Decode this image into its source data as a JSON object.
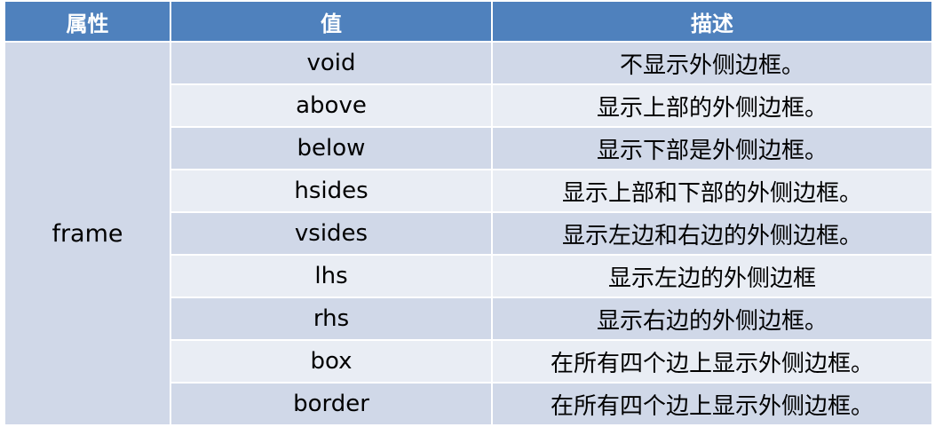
{
  "header": {
    "attribute": "属性",
    "value": "值",
    "description": "描述"
  },
  "attribute_name": "frame",
  "rows": [
    {
      "value": "void",
      "description": "不显示外侧边框。"
    },
    {
      "value": "above",
      "description": "显示上部的外侧边框。"
    },
    {
      "value": "below",
      "description": "显示下部是外侧边框。"
    },
    {
      "value": "hsides",
      "description": "显示上部和下部的外侧边框。"
    },
    {
      "value": "vsides",
      "description": "显示左边和右边的外侧边框。"
    },
    {
      "value": "lhs",
      "description": "显示左边的外侧边框"
    },
    {
      "value": "rhs",
      "description": "显示右边的外侧边框。"
    },
    {
      "value": "box",
      "description": "在所有四个边上显示外侧边框。"
    },
    {
      "value": "border",
      "description": "在所有四个边上显示外侧边框。"
    }
  ],
  "colors": {
    "header_bg": "#4f81bd",
    "row_dark": "#d0d8e8",
    "row_light": "#e9edf4"
  }
}
